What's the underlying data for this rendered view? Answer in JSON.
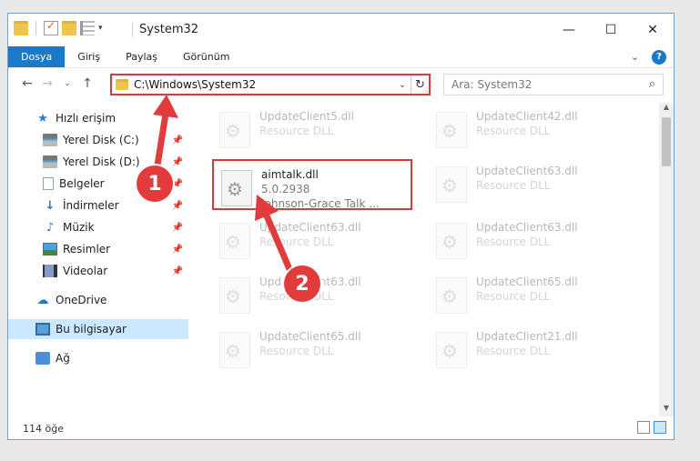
{
  "title": "System32",
  "ribbon": {
    "tabs": [
      "Dosya",
      "Giriş",
      "Paylaş",
      "Görünüm"
    ]
  },
  "address": {
    "path": "C:\\Windows\\System32"
  },
  "search": {
    "placeholder": "Ara: System32"
  },
  "sidebar": {
    "quick_access": "Hızlı erişim",
    "items": [
      {
        "label": "Yerel Disk (C:)",
        "icon": "drive-icon"
      },
      {
        "label": "Yerel Disk (D:)",
        "icon": "drive-icon"
      },
      {
        "label": "Belgeler",
        "icon": "document-icon"
      },
      {
        "label": "İndirmeler",
        "icon": "download-icon"
      },
      {
        "label": "Müzik",
        "icon": "music-icon"
      },
      {
        "label": "Resimler",
        "icon": "pictures-icon"
      },
      {
        "label": "Videolar",
        "icon": "videos-icon"
      }
    ],
    "onedrive": "OneDrive",
    "this_pc": "Bu bilgisayar",
    "network": "Ağ"
  },
  "files": {
    "left": [
      {
        "name": "UpdateClient5.dll",
        "type": "Resource DLL"
      },
      {
        "name": "aimtalk.dll",
        "version": "5.0.2938",
        "desc": "Johnson-Grace Talk ..."
      },
      {
        "name": "UpdateClient63.dll",
        "type": "Resource DLL"
      },
      {
        "name": "UpdateClient63.dll",
        "type": "Resource DLL"
      },
      {
        "name": "UpdateClient65.dll",
        "type": "Resource DLL"
      }
    ],
    "right": [
      {
        "name": "UpdateClient42.dll",
        "type": "Resource DLL"
      },
      {
        "name": "UpdateClient63.dll",
        "type": "Resource DLL"
      },
      {
        "name": "UpdateClient63.dll",
        "type": "Resource DLL"
      },
      {
        "name": "UpdateClient65.dll",
        "type": "Resource DLL"
      },
      {
        "name": "UpdateClient21.dll",
        "type": "Resource DLL"
      }
    ]
  },
  "status": {
    "count": "114 öğe"
  },
  "annotations": {
    "step1": "1",
    "step2": "2"
  },
  "colors": {
    "accent": "#1979ca",
    "highlight": "#d93a3a",
    "marker": "#e23b3b"
  }
}
